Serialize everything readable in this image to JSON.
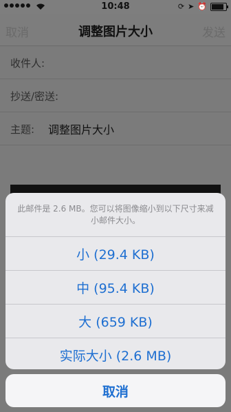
{
  "status_bar": {
    "time": "10:48",
    "battery_level": 0.9
  },
  "nav": {
    "left": "取消",
    "title": "调整图片大小",
    "right": "发送"
  },
  "fields": {
    "to_label": "收件人:",
    "cc_label": "抄送/密送:",
    "subject_label": "主题:",
    "subject_value": "调整图片大小"
  },
  "sheet": {
    "message": "此邮件是 2.6 MB。您可以将图像缩小到以下尺寸来减小邮件大小。",
    "options": [
      "小 (29.4 KB)",
      "中 (95.4 KB)",
      "大 (659 KB)",
      "实际大小 (2.6 MB)"
    ],
    "cancel": "取消"
  },
  "colors": {
    "accent": "#1e6fd1",
    "dim_overlay": "#7b7b7b"
  }
}
